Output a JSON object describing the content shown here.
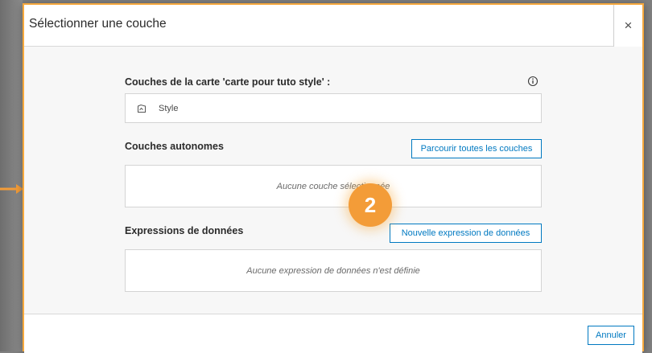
{
  "dialog": {
    "title": "Sélectionner une couche",
    "close_label": "×"
  },
  "map_layers": {
    "title": "Couches de la carte 'carte pour tuto style' :",
    "items": [
      {
        "label": "Style",
        "icon": "layer-polygon-icon"
      }
    ]
  },
  "standalone_layers": {
    "title": "Couches autonomes",
    "browse_button": "Parcourir toutes les couches",
    "empty_text": "Aucune couche sélectionnée"
  },
  "data_expressions": {
    "title": "Expressions de données",
    "new_button": "Nouvelle expression de données",
    "empty_text": "Aucune expression de données n'est définie"
  },
  "footer": {
    "cancel_button": "Annuler"
  },
  "annotation": {
    "step_number": "2"
  },
  "colors": {
    "accent": "#0079c1",
    "highlight": "#f6a83c"
  }
}
